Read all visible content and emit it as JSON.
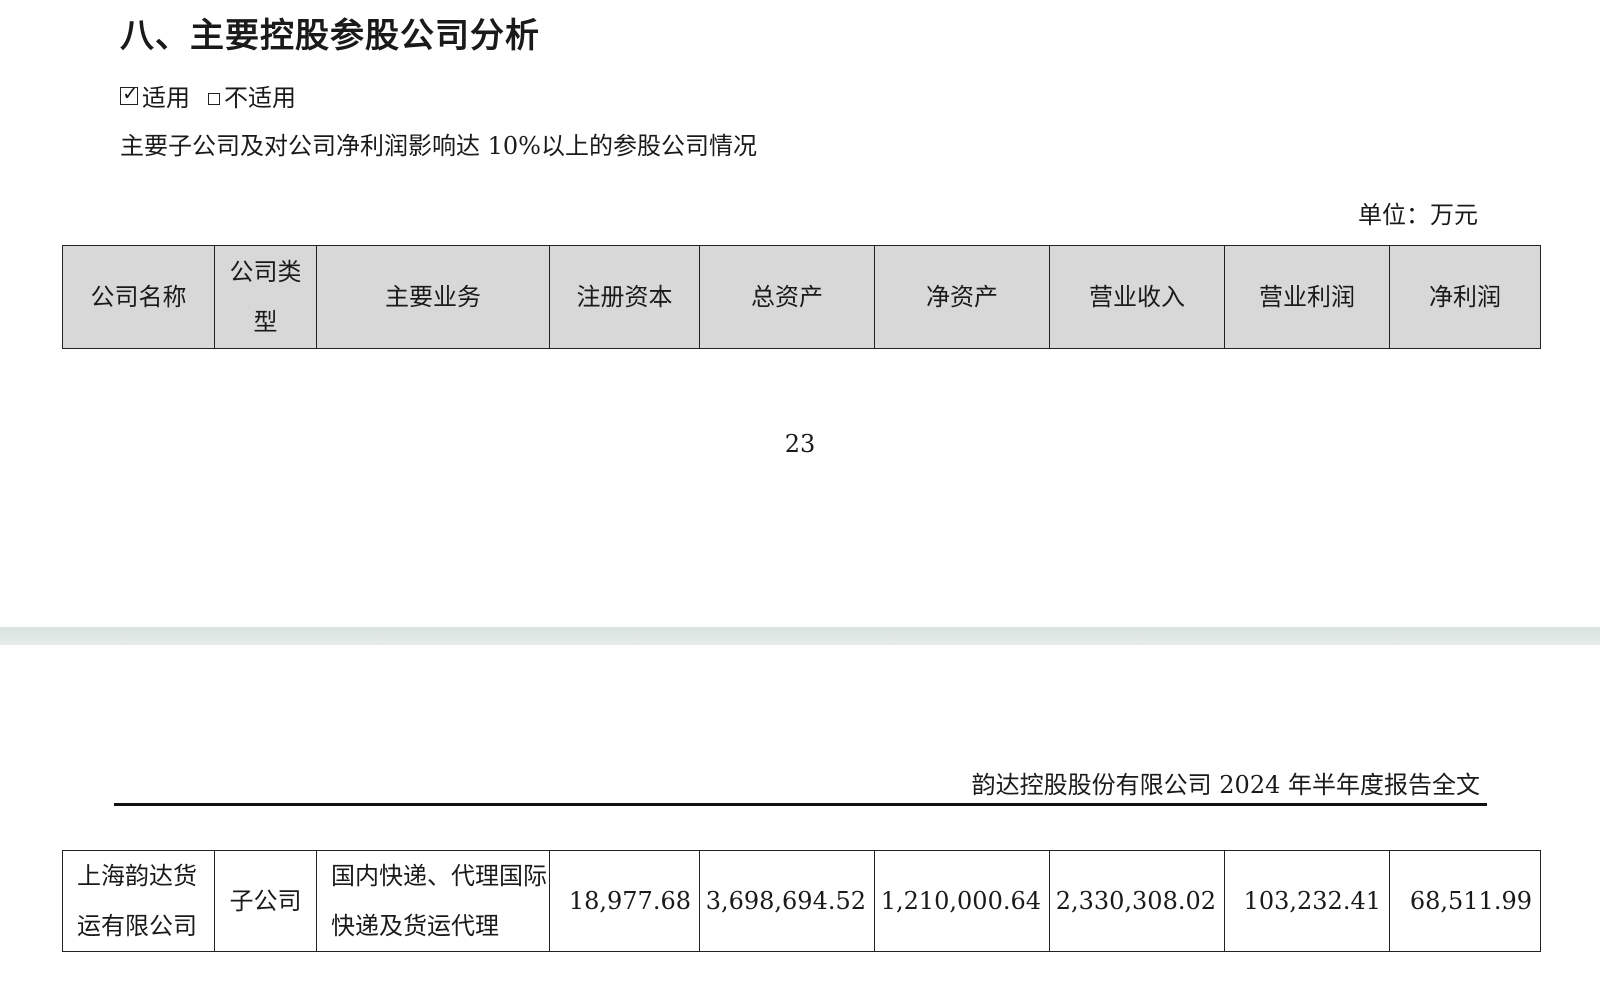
{
  "section_heading": "八、主要控股参股公司分析",
  "applicability": {
    "applicable_label": "适用",
    "not_applicable_label": "不适用",
    "checked": "applicable"
  },
  "intro_text": "主要子公司及对公司净利润影响达 10%以上的参股公司情况",
  "unit_label": "单位：万元",
  "table": {
    "headers": [
      "公司名称",
      "公司类型",
      "主要业务",
      "注册资本",
      "总资产",
      "净资产",
      "营业收入",
      "营业利润",
      "净利润"
    ],
    "header_type_line1": "公司类",
    "header_type_line2": "型",
    "rows": [
      {
        "name": "上海韵达货运有限公司",
        "type": "子公司",
        "business": "国内快递、代理国际快递及货运代理",
        "registered_capital": "18,977.68",
        "total_assets": "3,698,694.52",
        "net_assets": "1,210,000.64",
        "revenue": "2,330,308.02",
        "operating_profit": "103,232.41",
        "net_profit": "68,511.99"
      }
    ]
  },
  "page_number": "23",
  "running_header": "韵达控股股份有限公司 2024 年半年度报告全文"
}
